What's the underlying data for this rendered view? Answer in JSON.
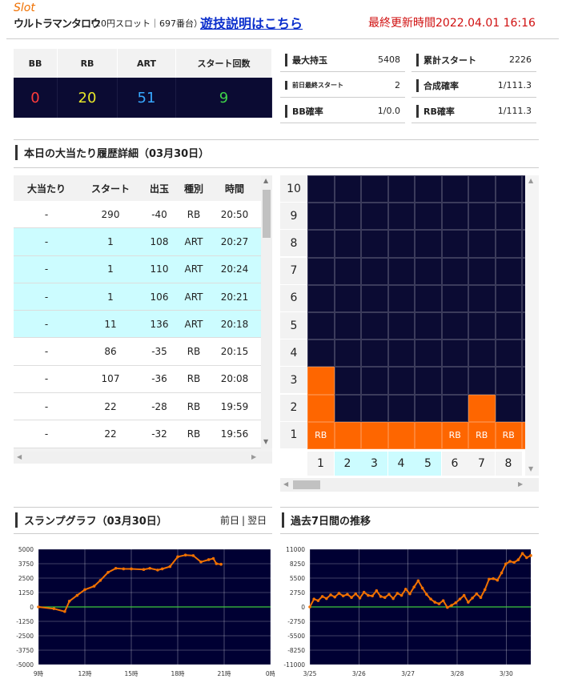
{
  "header": {
    "slot": "Slot",
    "machine": "ウルトラマンタロウ",
    "info": "（20円スロット｜697番台）",
    "guide_link": "遊技説明はこちら",
    "updated": "最終更新時間2022.04.01 16:16"
  },
  "summary": {
    "cols": [
      "BB",
      "RB",
      "ART",
      "スタート回数"
    ],
    "values": [
      "0",
      "20",
      "51",
      "9"
    ],
    "colors": [
      "#ff3b3b",
      "#e6e62a",
      "#37a8ff",
      "#3ed24a"
    ]
  },
  "stats": [
    {
      "k": "最大持玉",
      "v": "5408"
    },
    {
      "k": "累計スタート",
      "v": "2226"
    },
    {
      "k": "前日最終スタート",
      "v": "2"
    },
    {
      "k": "合成確率",
      "v": "1/111.3"
    },
    {
      "k": "BB確率",
      "v": "1/0.0"
    },
    {
      "k": "RB確率",
      "v": "1/111.3"
    }
  ],
  "history": {
    "title": "本日の大当たり履歴詳細（03月30日）",
    "headers": [
      "大当たり",
      "スタート",
      "出玉",
      "種別",
      "時間"
    ],
    "rows": [
      [
        "-",
        "290",
        "-40",
        "RB",
        "20:50"
      ],
      [
        "-",
        "1",
        "108",
        "ART",
        "20:27"
      ],
      [
        "-",
        "1",
        "110",
        "ART",
        "20:24"
      ],
      [
        "-",
        "1",
        "106",
        "ART",
        "20:21"
      ],
      [
        "-",
        "11",
        "136",
        "ART",
        "20:18"
      ],
      [
        "-",
        "86",
        "-35",
        "RB",
        "20:15"
      ],
      [
        "-",
        "107",
        "-36",
        "RB",
        "20:08"
      ],
      [
        "-",
        "22",
        "-28",
        "RB",
        "19:59"
      ],
      [
        "-",
        "22",
        "-32",
        "RB",
        "19:56"
      ]
    ]
  },
  "grid": {
    "y_labels": [
      "10",
      "9",
      "8",
      "7",
      "6",
      "5",
      "4",
      "3",
      "2",
      "1"
    ],
    "x_labels": [
      "1",
      "2",
      "3",
      "4",
      "5",
      "6",
      "7",
      "8"
    ],
    "x_highlight": [
      false,
      true,
      true,
      true,
      true,
      false,
      false,
      false
    ],
    "col_heights": [
      3,
      1,
      1,
      1,
      1,
      1,
      2,
      1,
      1
    ],
    "row1_text": [
      "RB",
      "",
      "",
      "",
      "",
      "RB",
      "RB",
      "RB",
      ""
    ]
  },
  "slump": {
    "title": "スランプグラフ（03月30日）",
    "nav_prev": "前日",
    "nav_sep": "|",
    "nav_next": "翌日"
  },
  "weekly": {
    "title": "過去7日間の推移"
  },
  "chart_data": [
    {
      "type": "line",
      "yticks": [
        "5000",
        "3750",
        "2500",
        "1250",
        "0",
        "-1250",
        "-2500",
        "-3750",
        "-5000"
      ],
      "xticks": [
        "9時",
        "12時",
        "15時",
        "18時",
        "21時",
        "0時"
      ],
      "ylim": [
        -5000,
        5000
      ],
      "xlim": [
        9,
        24
      ],
      "x": [
        9,
        10,
        10.7,
        11,
        11.5,
        12,
        12.6,
        13,
        13.5,
        14,
        14.5,
        15,
        15.8,
        16.2,
        16.7,
        17,
        17.5,
        18,
        18.5,
        19,
        19.5,
        20,
        20.3,
        20.5,
        20.8
      ],
      "y": [
        0,
        -150,
        -400,
        500,
        1000,
        1500,
        1800,
        2300,
        3000,
        3350,
        3300,
        3300,
        3250,
        3350,
        3200,
        3300,
        3500,
        4350,
        4500,
        4450,
        3900,
        4100,
        4200,
        3750,
        3700
      ],
      "line_color": "#f07000",
      "zero_color": "#3cc83c"
    },
    {
      "type": "line",
      "yticks": [
        "11000",
        "8250",
        "5500",
        "2750",
        "0",
        "-2750",
        "-5500",
        "-8250",
        "-11000"
      ],
      "xticks": [
        "3/25",
        "3/26",
        "3/27",
        "3/28",
        "3/30"
      ],
      "ylim": [
        -11000,
        11000
      ],
      "xlim": [
        0,
        53
      ],
      "x": [
        0,
        1,
        2,
        3,
        4,
        5,
        6,
        7,
        8,
        9,
        10,
        11,
        12,
        13,
        14,
        15,
        16,
        17,
        18,
        19,
        20,
        21,
        22,
        23,
        24,
        25,
        26,
        27,
        28,
        29,
        30,
        31,
        32,
        33,
        34,
        35,
        36,
        37,
        38,
        39,
        40,
        41,
        42,
        43,
        44,
        45,
        46,
        47,
        48,
        49,
        50,
        51,
        52,
        53
      ],
      "y": [
        0,
        1500,
        1200,
        2000,
        1600,
        2300,
        1900,
        2600,
        2100,
        2400,
        1800,
        2500,
        1700,
        2800,
        2200,
        2100,
        3100,
        2000,
        1800,
        2400,
        1600,
        2600,
        2200,
        3400,
        2500,
        3800,
        5000,
        3600,
        2400,
        1500,
        900,
        600,
        1200,
        -100,
        300,
        800,
        1500,
        2200,
        900,
        1700,
        2500,
        1800,
        3300,
        5300,
        5400,
        5100,
        6500,
        8200,
        8700,
        8500,
        9000,
        10200,
        9400,
        9800
      ],
      "line_color": "#f07000",
      "zero_color": "#3cc83c"
    }
  ]
}
